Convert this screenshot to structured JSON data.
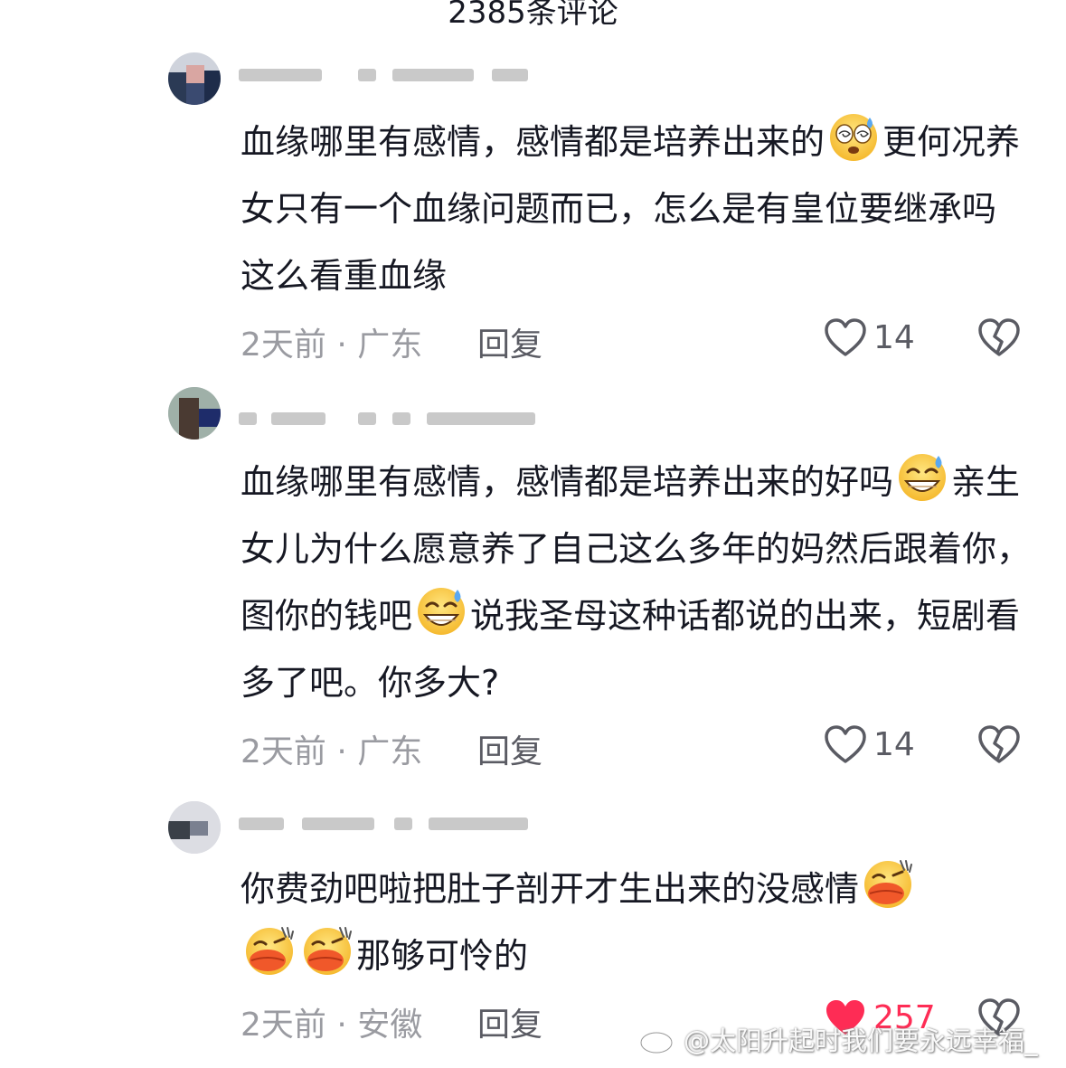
{
  "header": {
    "title": "2385条评论"
  },
  "comments": [
    {
      "text_parts": [
        "血缘哪里有感情，感情都是培养出来的",
        "更何况养女只有一个血缘问题而已，怎么是有皇位要继承吗 这么看重血缘"
      ],
      "time_location": "2天前 · 广东",
      "reply_label": "回复",
      "like_count": "14",
      "liked": false
    },
    {
      "text_parts": [
        "血缘哪里有感情，感情都是培养出来的好吗",
        "亲生女儿为什么愿意养了自己这么多年的妈然后跟着你，图你的钱吧",
        "说我圣母这种话都说的出来，短剧看多了吧。你多大?"
      ],
      "time_location": "2天前 · 广东",
      "reply_label": "回复",
      "like_count": "14",
      "liked": false
    },
    {
      "text_parts": [
        "你费劲吧啦把肚子剖开才生出来的没感情",
        "那够可怜的"
      ],
      "time_location": "2天前 · 安徽",
      "reply_label": "回复",
      "like_count": "257",
      "liked": true
    }
  ],
  "watermark": {
    "text": "@太阳升起时我们要永远幸福_"
  },
  "colors": {
    "like_active": "#fe2c55",
    "meta_gray": "#9a9ba1",
    "text": "#161823"
  }
}
